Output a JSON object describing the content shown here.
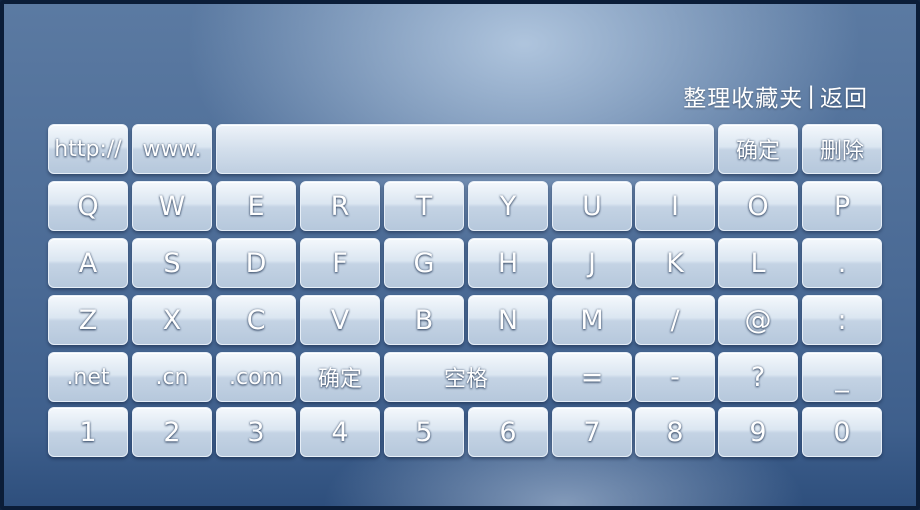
{
  "header": {
    "favorites": "整理收藏夹",
    "separator": "|",
    "back": "返回"
  },
  "url_input": {
    "value": ""
  },
  "keyboard": {
    "row0": {
      "http": "http://",
      "www": "www.",
      "confirm": "确定",
      "delete": "删除"
    },
    "row1": [
      "Q",
      "W",
      "E",
      "R",
      "T",
      "Y",
      "U",
      "I",
      "O",
      "P"
    ],
    "row2": [
      "A",
      "S",
      "D",
      "F",
      "G",
      "H",
      "J",
      "K",
      "L",
      "."
    ],
    "row3": [
      "Z",
      "X",
      "C",
      "V",
      "B",
      "N",
      "M",
      "/",
      "@",
      ":"
    ],
    "row4": {
      "net": ".net",
      "cn": ".cn",
      "com": ".com",
      "confirm": "确定",
      "space": "空格",
      "equals": "=",
      "minus": "-",
      "question": "?",
      "underscore": "_"
    },
    "row5": [
      "1",
      "2",
      "3",
      "4",
      "5",
      "6",
      "7",
      "8",
      "9",
      "0"
    ]
  }
}
